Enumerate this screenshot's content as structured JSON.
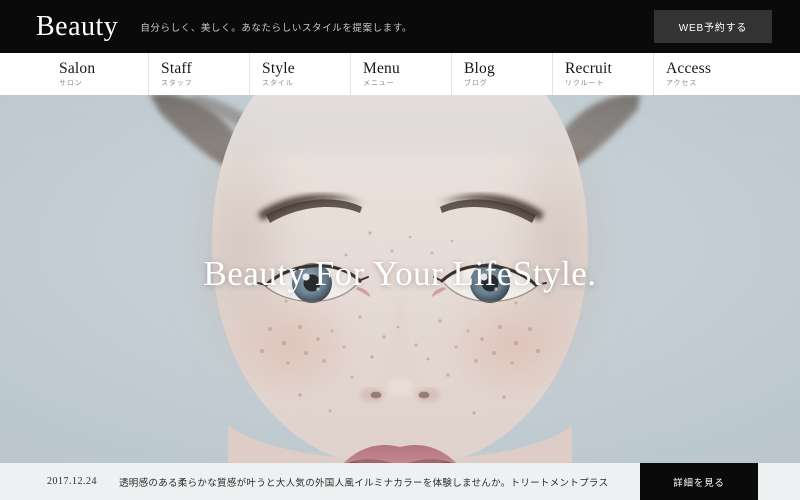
{
  "header": {
    "logo": "Beauty",
    "tagline": "自分らしく、美しく。あなたらしいスタイルを提案します。",
    "reserve_button": "WEB予約する",
    "background_color": "#0a0a0a",
    "button_color": "#333333"
  },
  "nav": {
    "items": [
      {
        "en": "Salon",
        "jp": "サロン"
      },
      {
        "en": "Staff",
        "jp": "スタッフ"
      },
      {
        "en": "Style",
        "jp": "スタイル"
      },
      {
        "en": "Menu",
        "jp": "メニュー"
      },
      {
        "en": "Blog",
        "jp": "ブログ"
      },
      {
        "en": "Recruit",
        "jp": "リクルート"
      },
      {
        "en": "Access",
        "jp": "アクセス"
      }
    ]
  },
  "hero": {
    "title": "Beauty For Your LifeStyle.",
    "image_description": "close-up portrait of a freckled woman with blue-grey eyes on pale blue background",
    "background_color": "#c2cdd3",
    "skin_color": "#e8ddd7",
    "eye_color": "#6f8894",
    "lip_color": "#c0757a",
    "hair_color": "#3b2e27"
  },
  "news": {
    "date": "2017.12.24",
    "text": "透明感のある柔らかな質感が叶うと大人気の外国人風イルミナカラーを体験しませんか。トリートメントプラスで色モチ...",
    "detail_button": "詳細を見る",
    "background_color": "#eef1f2"
  }
}
